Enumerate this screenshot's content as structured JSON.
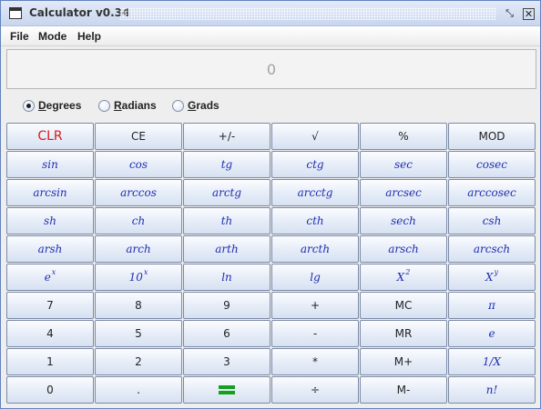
{
  "window": {
    "title": "Calculator v0.34",
    "restore_glyph": "⤡",
    "close_glyph": "✕"
  },
  "menu": {
    "items": [
      "File",
      "Mode",
      "Help"
    ]
  },
  "display": {
    "value": "0"
  },
  "angle_modes": [
    {
      "label": "Degrees",
      "underline": "D",
      "checked": true
    },
    {
      "label": "Radians",
      "underline": "R",
      "checked": false
    },
    {
      "label": "Grads",
      "underline": "G",
      "checked": false
    }
  ],
  "keys": {
    "row0": [
      "CLR",
      "CE",
      "+/-",
      "√",
      "%",
      "MOD"
    ],
    "row1": [
      "sin",
      "cos",
      "tg",
      "ctg",
      "sec",
      "cosec"
    ],
    "row2": [
      "arcsin",
      "arccos",
      "arctg",
      "arcctg",
      "arcsec",
      "arccosec"
    ],
    "row3": [
      "sh",
      "ch",
      "th",
      "cth",
      "sech",
      "csh"
    ],
    "row4": [
      "arsh",
      "arch",
      "arth",
      "arcth",
      "arsch",
      "arcsch"
    ],
    "row5": [
      {
        "base": "e",
        "sup": "x"
      },
      {
        "base": "10",
        "sup": "x"
      },
      {
        "base": "ln",
        "sup": ""
      },
      {
        "base": "lg",
        "sup": ""
      },
      {
        "base": "X",
        "sup": "2"
      },
      {
        "base": "X",
        "sup": "y"
      }
    ],
    "row6": [
      "7",
      "8",
      "9",
      "+",
      "MC",
      "π"
    ],
    "row7": [
      "4",
      "5",
      "6",
      "-",
      "MR",
      "e"
    ],
    "row8": [
      "1",
      "2",
      "3",
      "*",
      "M+",
      "1/X"
    ],
    "row9": [
      "0",
      ".",
      "=",
      "÷",
      "M-",
      "n!"
    ]
  },
  "colors": {
    "clr": "#d81a1a",
    "function_text": "#1f2fb0",
    "equals": "#11a11b"
  }
}
